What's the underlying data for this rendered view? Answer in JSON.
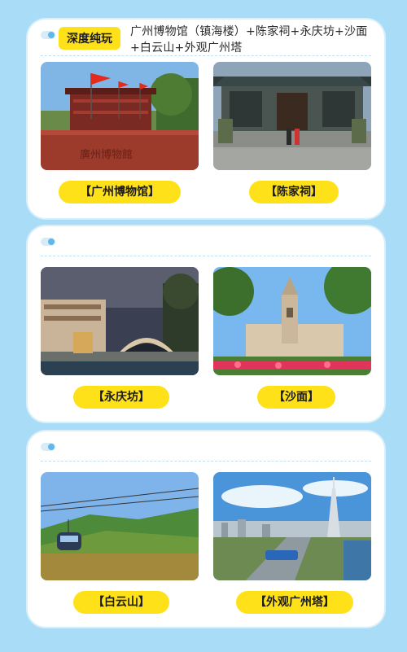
{
  "section1": {
    "badge": "深度纯玩",
    "title": "广州博物馆（镇海楼）+陈家祠+永庆坊+沙面+白云山+外观广州塔",
    "photos": [
      {
        "label": "【广州博物馆】",
        "icon": "guangzhou-museum-photo"
      },
      {
        "label": "【陈家祠】",
        "icon": "chen-clan-academy-photo"
      }
    ]
  },
  "section2": {
    "photos": [
      {
        "label": "【永庆坊】",
        "icon": "yongqingfang-photo"
      },
      {
        "label": "【沙面】",
        "icon": "shamian-photo"
      }
    ]
  },
  "section3": {
    "photos": [
      {
        "label": "【白云山】",
        "icon": "baiyun-mountain-photo"
      },
      {
        "label": "【外观广州塔】",
        "icon": "canton-tower-photo"
      }
    ]
  },
  "colors": {
    "background": "#a9dcf7",
    "card": "#ffffff",
    "accent_yellow": "#ffe11a",
    "toggle_blue": "#5fb7ea"
  }
}
